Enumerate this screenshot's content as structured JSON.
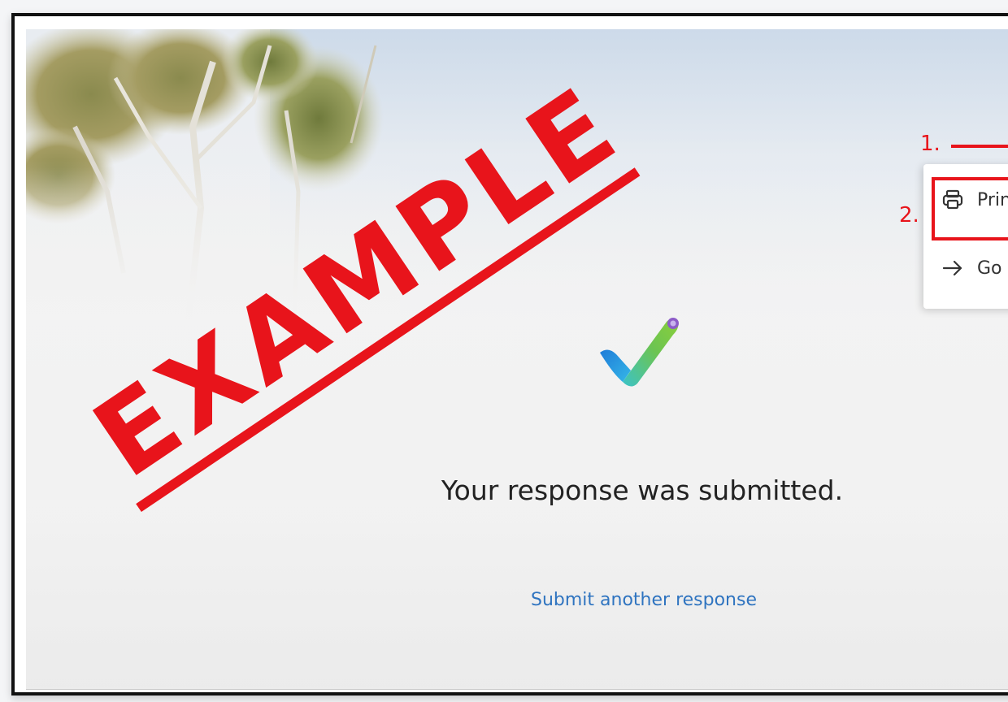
{
  "page": {
    "confirmation_message": "Your response was submitted.",
    "submit_another_link": "Submit another response"
  },
  "menu": {
    "print_label": "Print",
    "goto_label": "Go"
  },
  "annotations": {
    "step_1": "1.",
    "step_2": "2.",
    "stamp_text": "EXAMPLE",
    "accent_color": "#e8141b"
  },
  "icons": {
    "print": "printer-icon",
    "goto": "arrow-right-icon",
    "success": "checkmark-icon"
  },
  "colors": {
    "link": "#2f74c0",
    "text": "#222222"
  }
}
